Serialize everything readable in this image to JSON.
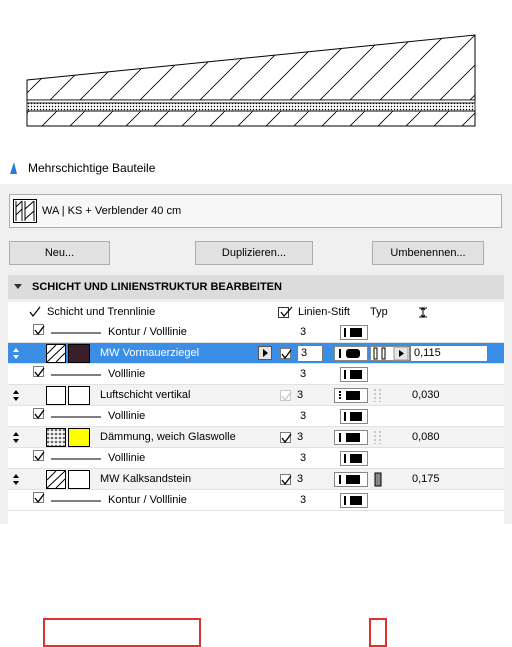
{
  "dialog": {
    "title": "Mehrschichtige Bauteile",
    "composite_name": "WA | KS + Verblender 40 cm",
    "buttons": {
      "new": "Neu...",
      "duplicate": "Duplizieren...",
      "rename": "Umbenennen..."
    },
    "section_title": "SCHICHT UND LINIENSTRUKTUR BEARBEITEN"
  },
  "table": {
    "headers": {
      "layer": "Schicht und Trennlinie",
      "pen": "Linien-Stift",
      "type": "Typ",
      "thickness_icon": "thickness-icon"
    },
    "rows": [
      {
        "kind": "contour",
        "label": "Kontur / Volllinie",
        "pen": "3"
      },
      {
        "kind": "layer",
        "label": "MW Vormauerziegel",
        "pen": "3",
        "thickness": "0,115",
        "selected": true,
        "fill_color": "#3a1f2a"
      },
      {
        "kind": "contour",
        "label": "Volllinie",
        "pen": "3"
      },
      {
        "kind": "layer",
        "label": "Luftschicht vertikal",
        "pen": "3",
        "thickness": "0,030",
        "fill_color": "#ffffff"
      },
      {
        "kind": "contour",
        "label": "Volllinie",
        "pen": "3"
      },
      {
        "kind": "layer",
        "label": "Dämmung, weich Glaswolle",
        "pen": "3",
        "thickness": "0,080",
        "fill_color": "#ffff00"
      },
      {
        "kind": "contour",
        "label": "Volllinie",
        "pen": "3"
      },
      {
        "kind": "layer",
        "label": "MW Kalksandstein",
        "pen": "3",
        "thickness": "0,175",
        "fill_color": "#ffffff",
        "highlighted": true
      },
      {
        "kind": "contour",
        "label": "Kontur / Volllinie",
        "pen": "3"
      }
    ]
  },
  "colors": {
    "selection": "#3a8ee6",
    "highlight": "#e03030"
  }
}
